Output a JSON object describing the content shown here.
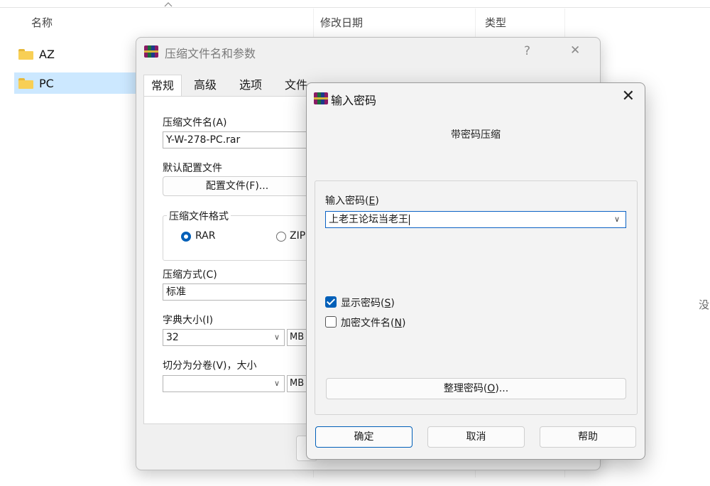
{
  "explorer": {
    "columns": {
      "name": "名称",
      "modified": "修改日期",
      "type": "类型"
    },
    "items": [
      {
        "name": "AZ",
        "icon": "folder-icon",
        "selected": false
      },
      {
        "name": "PC",
        "icon": "folder-icon",
        "selected": true
      }
    ],
    "side_text": "没"
  },
  "archive_dialog": {
    "title": "压缩文件名和参数",
    "help": "?",
    "close": "✕",
    "tabs": [
      "常规",
      "高级",
      "选项",
      "文件"
    ],
    "archive_name_label": "压缩文件名(A)",
    "archive_name_value": "Y-W-278-PC.rar",
    "default_profile_label": "默认配置文件",
    "profiles_button": "配置文件(F)...",
    "format_group": "压缩文件格式",
    "format_options": [
      "RAR",
      "ZIP"
    ],
    "format_selected": "RAR",
    "method_label": "压缩方式(C)",
    "method_value": "标准",
    "dict_label": "字典大小(I)",
    "dict_value": "32",
    "dict_unit": "MB",
    "split_label": "切分为分卷(V)，大小",
    "split_value": "",
    "split_unit": "MB"
  },
  "password_dialog": {
    "title": "输入密码",
    "close": "✕",
    "subtitle": "带密码压缩",
    "enter_label": "输入密码",
    "enter_key": "E",
    "password_value": "上老王论坛当老王",
    "show_password_label": "显示密码",
    "show_password_key": "S",
    "show_password_checked": true,
    "encrypt_names_label": "加密文件名",
    "encrypt_names_key": "N",
    "encrypt_names_checked": false,
    "organize_label": "整理密码",
    "organize_key": "O",
    "organize_suffix": "...",
    "ok": "确定",
    "cancel": "取消",
    "help": "帮助"
  },
  "colors": {
    "accent": "#005fb8",
    "selection": "#cce8ff",
    "folder": "#f8cf55"
  }
}
